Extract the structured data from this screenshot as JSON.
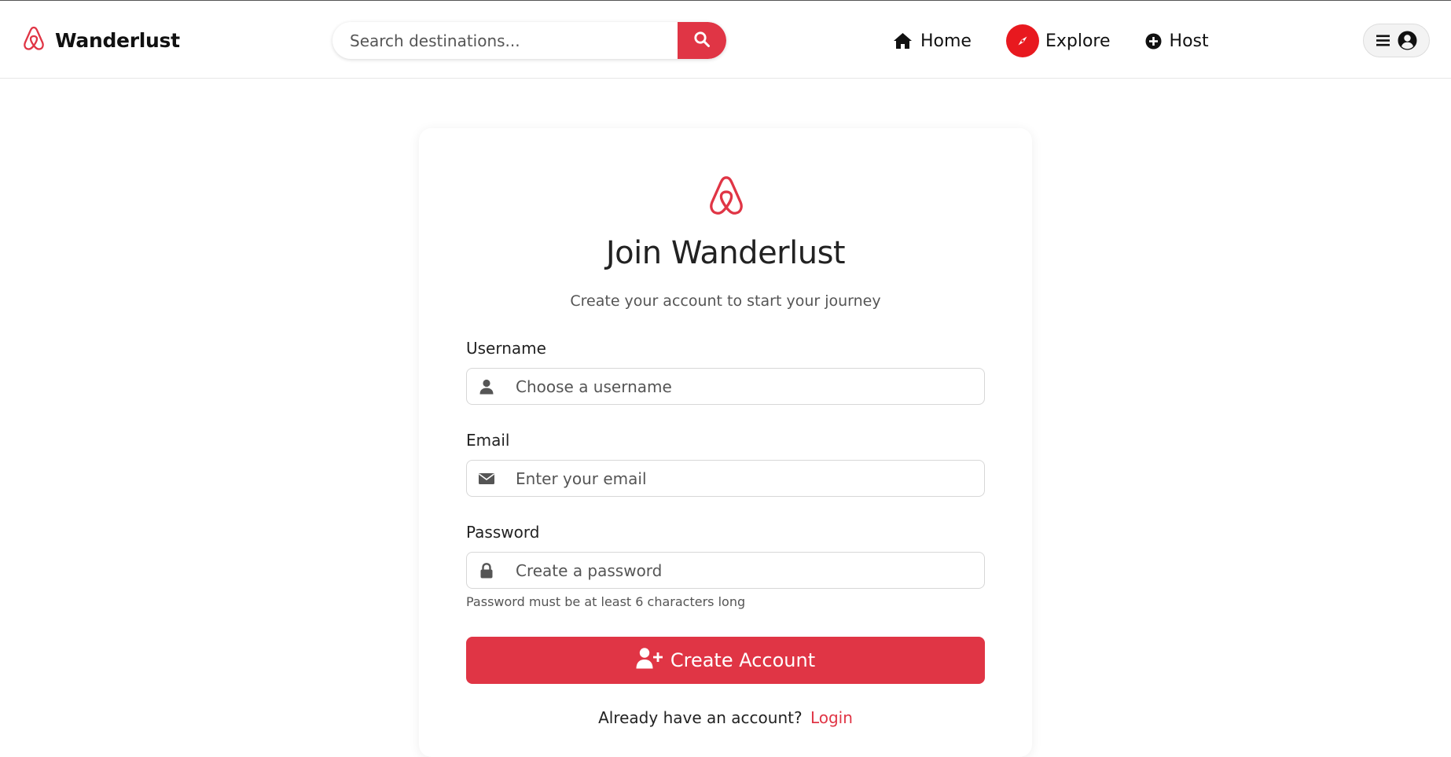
{
  "brand": {
    "name": "Wanderlust",
    "accent_color": "#e03545"
  },
  "search": {
    "placeholder": "Search destinations...",
    "button_icon": "search-icon"
  },
  "nav": {
    "home_label": "Home",
    "explore_label": "Explore",
    "host_label": "Host"
  },
  "user_menu": {
    "icons": [
      "menu-icon",
      "user-circle-icon"
    ]
  },
  "signup": {
    "title": "Join Wanderlust",
    "subtitle": "Create your account to start your journey",
    "username_label": "Username",
    "username_placeholder": "Choose a username",
    "email_label": "Email",
    "email_placeholder": "Enter your email",
    "password_label": "Password",
    "password_placeholder": "Create a password",
    "password_help": "Password must be at least 6 characters long",
    "submit_label": "Create Account",
    "login_prompt": "Already have an account?",
    "login_link": "Login"
  }
}
